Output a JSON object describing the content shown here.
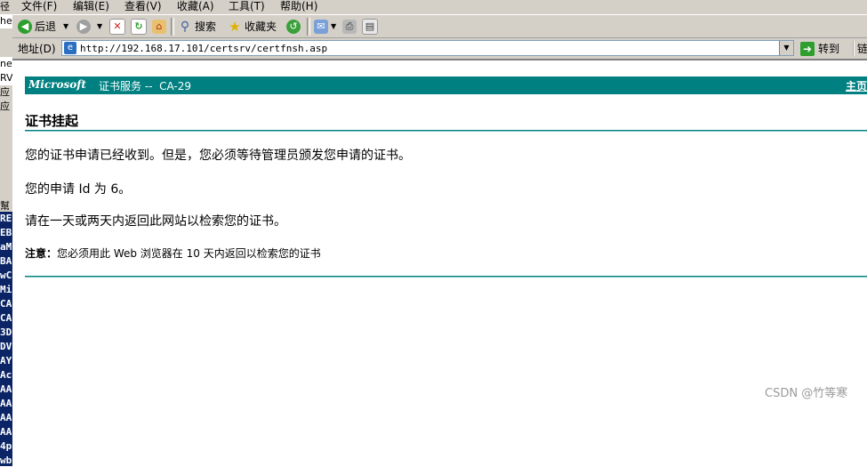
{
  "left_strip": {
    "top_chars": [
      "径",
      "he",
      "",
      "",
      "ne",
      "RV",
      "应",
      "应",
      "",
      "",
      "",
      "",
      "",
      "",
      "幫"
    ],
    "dark_chars": [
      "RE",
      "EB",
      "aM",
      "BA",
      "wC",
      "Mi",
      "CA",
      "CA",
      "3D",
      "DV",
      "AY",
      "Ac",
      "AA",
      "AA",
      "AA",
      "AA",
      "4p",
      "wb"
    ]
  },
  "menu": {
    "items": [
      "文件(F)",
      "编辑(E)",
      "查看(V)",
      "收藏(A)",
      "工具(T)",
      "帮助(H)"
    ]
  },
  "toolbar": {
    "back_label": "后退",
    "search_label": "搜索",
    "favorites_label": "收藏夹"
  },
  "address": {
    "label": "地址(D)",
    "url": "http://192.168.17.101/certsrv/certfnsh.asp",
    "go_label": "转到",
    "links_label": "链"
  },
  "page": {
    "brand": "Microsoft",
    "banner_title": "证书服务 --  CA-29",
    "home_link": "主页",
    "title": "证书挂起",
    "para1": "您的证书申请已经收到。但是，您必须等待管理员颁发您申请的证书。",
    "para2": "您的申请 Id 为 6。",
    "para3": "请在一天或两天内返回此网站以检索您的证书。",
    "note_label": "注意：",
    "note_text": "您必须用此 Web 浏览器在 10 天内返回以检索您的证书"
  },
  "watermark": "CSDN @竹等寒",
  "colors": {
    "banner": "#008080",
    "chrome": "#d4d0c8"
  }
}
